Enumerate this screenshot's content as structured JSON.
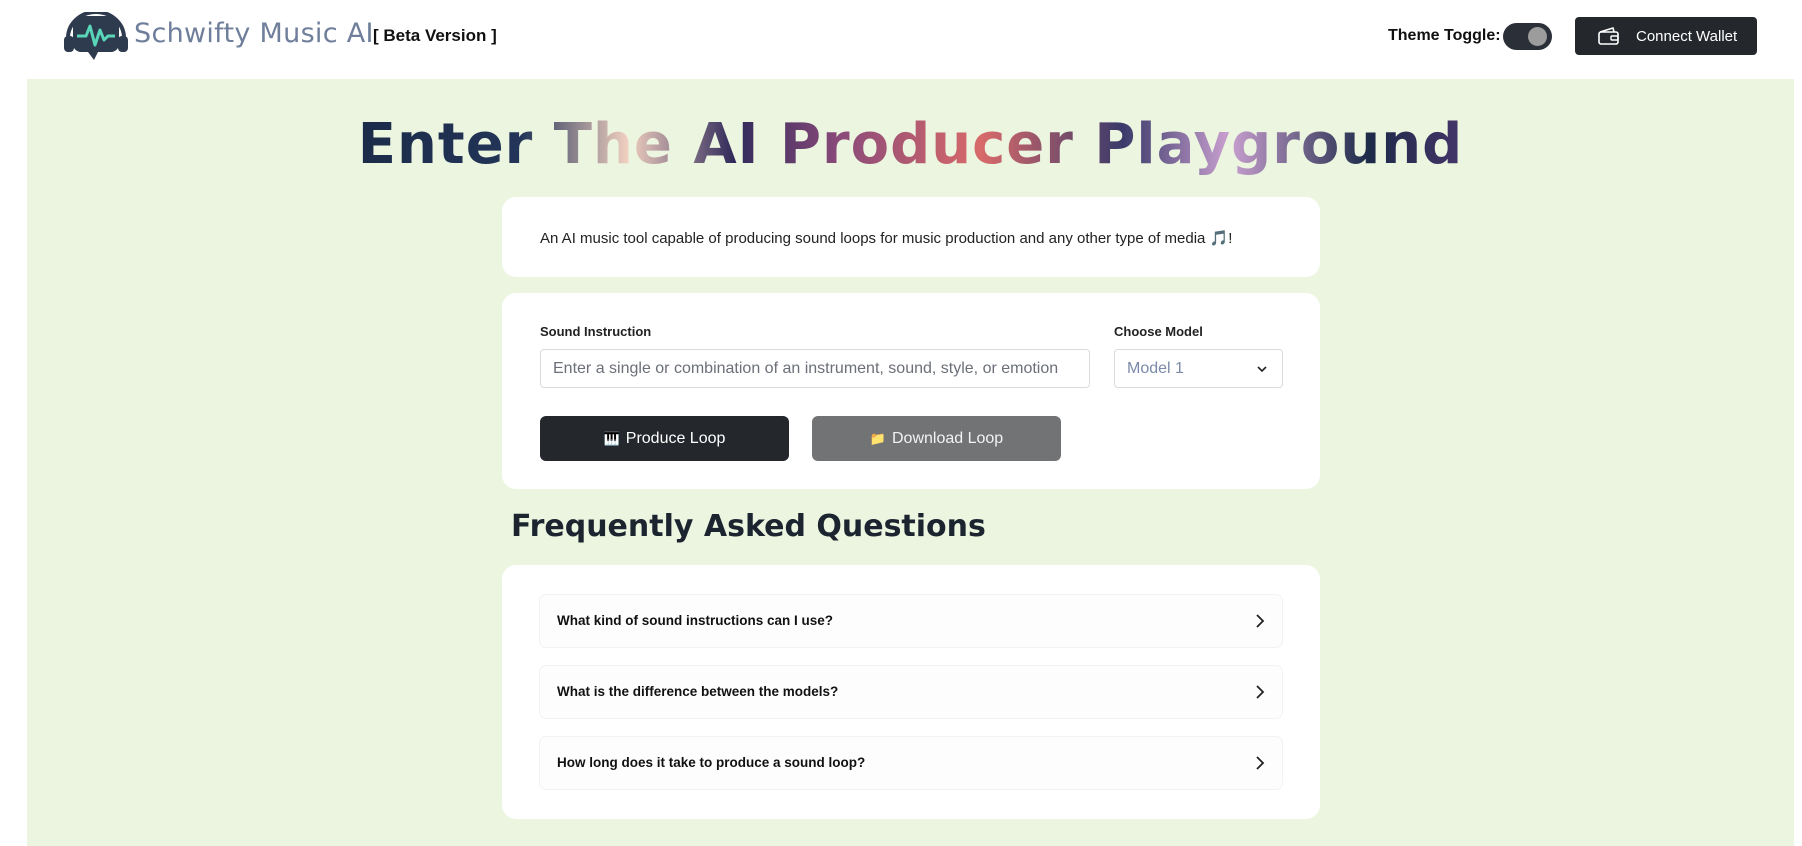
{
  "header": {
    "brand": "Schwifty Music AI",
    "badge": "[ Beta Version ]",
    "theme_label": "Theme Toggle:",
    "connect_wallet": "Connect Wallet"
  },
  "hero": {
    "title": "Enter The AI Producer Playground"
  },
  "description": "An AI music tool capable of producing sound loops for music production and any other type of media 🎵!",
  "form": {
    "sound_label": "Sound Instruction",
    "sound_placeholder": "Enter a single or combination of an instrument, sound, style, or emotion",
    "sound_value": "",
    "model_label": "Choose Model",
    "model_selected": "Model 1",
    "produce_icon": "🎹",
    "produce_label": "Produce Loop",
    "download_icon": "📁",
    "download_label": "Download Loop"
  },
  "faq": {
    "title": "Frequently Asked Questions",
    "items": [
      {
        "question": "What kind of sound instructions can I use?"
      },
      {
        "question": "What is the difference between the models?"
      },
      {
        "question": "How long does it take to produce a sound loop?"
      }
    ]
  },
  "colors": {
    "page_bg": "#ebf5df",
    "primary_button": "#24272c",
    "secondary_button": "#717375",
    "brand_text": "#6f7f9b"
  },
  "icons": {
    "logo": "headphones-waveform-icon",
    "wallet": "wallet-icon",
    "dropdown": "chevron-down-icon",
    "faq_expand": "chevron-right-icon"
  }
}
